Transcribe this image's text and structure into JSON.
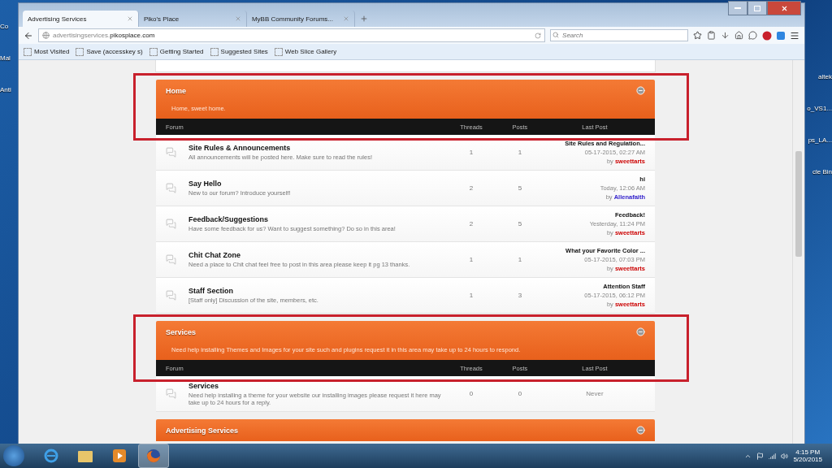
{
  "desktop": {
    "left_labels": [
      "Co",
      "Mal",
      "Anti"
    ],
    "right_labels": [
      "altek",
      "o_VS1...",
      "ps_LA...",
      "cle Bin"
    ]
  },
  "browser": {
    "tabs": [
      {
        "title": "Advertising Services",
        "selected": true
      },
      {
        "title": "Piko's Place",
        "selected": false
      },
      {
        "title": "MyBB Community Forums...",
        "selected": false
      }
    ],
    "url": "advertisingservices.**pikosplace.com**",
    "search": {
      "placeholder": "Search"
    },
    "bookmarks": [
      "Most Visited",
      "Save (accesskey s)",
      "Getting Started",
      "Suggested Sites",
      "Web Slice Gallery"
    ]
  },
  "categories": [
    {
      "title": "Home",
      "description": "Home, sweet home.",
      "annotated": true,
      "columns": [
        "Forum",
        "Threads",
        "Posts",
        "Last Post"
      ],
      "forums": [
        {
          "name": "Site Rules & Announcements",
          "description": "All announcements will be posted here. Make sure to read the rules!",
          "threads": "1",
          "posts": "1",
          "last_post": {
            "kind": "post",
            "title": "Site Rules and Regulation...",
            "date": "05-17-2015, 02:27 AM",
            "by": "by",
            "author": "sweettarts",
            "color": "#cc0000"
          }
        },
        {
          "name": "Say Hello",
          "description": "New to our forum? Introduce yourself!",
          "threads": "2",
          "posts": "5",
          "last_post": {
            "kind": "post",
            "title": "hi",
            "date": "Today, 12:06 AM",
            "by": "by",
            "author": "Allenafaith",
            "color": "#3322cc"
          }
        },
        {
          "name": "Feedback/Suggestions",
          "description": "Have some feedback for us? Want to suggest something? Do so in this area!",
          "threads": "2",
          "posts": "5",
          "last_post": {
            "kind": "post",
            "title": "Feedback!",
            "date": "Yesterday, 11:24 PM",
            "by": "by",
            "author": "sweettarts",
            "color": "#cc0000"
          }
        },
        {
          "name": "Chit Chat Zone",
          "description": "Need a place to Chit chat feel free to post in this area please keep it pg 13 thanks.",
          "threads": "1",
          "posts": "1",
          "last_post": {
            "kind": "post",
            "title": "What your Favorite Color ...",
            "date": "05-17-2015, 07:03 PM",
            "by": "by",
            "author": "sweettarts",
            "color": "#cc0000"
          }
        },
        {
          "name": "Staff Section",
          "description": "[Staff only] Discussion of the site, members, etc.",
          "threads": "1",
          "posts": "3",
          "last_post": {
            "kind": "post",
            "title": "Attention Staff",
            "date": "05-17-2015, 06:12 PM",
            "by": "by",
            "author": "sweettarts",
            "color": "#cc0000"
          }
        }
      ]
    },
    {
      "title": "Services",
      "description": "Need help installing Themes and Images for your site such and plugins request it in this area may take up to 24 hours to respond.",
      "annotated": true,
      "columns": [
        "Forum",
        "Threads",
        "Posts",
        "Last Post"
      ],
      "forums": [
        {
          "name": "Services",
          "description": "Need help installing a theme for your website our installing images please request it here may take up to 24 hours for a reply.",
          "threads": "0",
          "posts": "0",
          "last_post": {
            "kind": "never",
            "text": "Never"
          }
        }
      ]
    },
    {
      "title": "Advertising Services",
      "annotated": false
    }
  ],
  "taskbar": {
    "apps": [
      {
        "kind": "ie",
        "selected": false
      },
      {
        "kind": "folder",
        "selected": false
      },
      {
        "kind": "media",
        "selected": false
      },
      {
        "kind": "firefox",
        "selected": true
      }
    ],
    "time": "4:15 PM",
    "date": "5/20/2015"
  }
}
